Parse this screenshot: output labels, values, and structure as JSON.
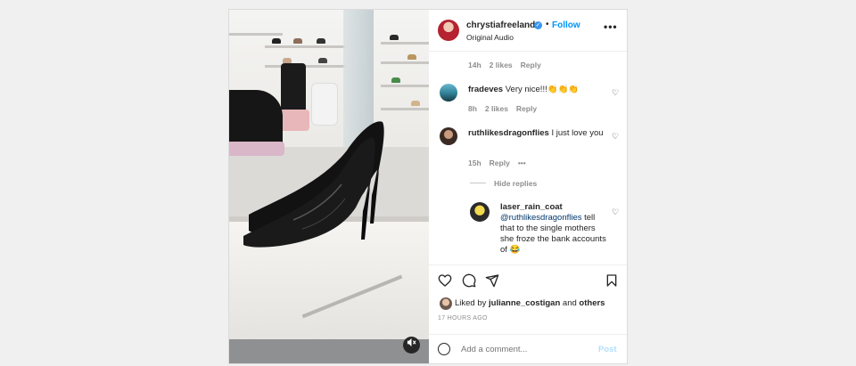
{
  "header": {
    "username": "chrystiafreeland",
    "dot": "•",
    "follow_label": "Follow",
    "audio": "Original Audio",
    "more": "•••"
  },
  "caption_meta": {
    "time": "14h",
    "likes": "2 likes",
    "reply": "Reply"
  },
  "comments": [
    {
      "user": "fradeves",
      "text": "Very nice!!!👏👏👏",
      "time": "8h",
      "likes": "2 likes",
      "reply": "Reply"
    },
    {
      "user": "ruthlikesdragonflies",
      "text": "I just love you",
      "time": "15h",
      "reply": "Reply",
      "more": "•••"
    }
  ],
  "hide_replies": "Hide replies",
  "reply_comment": {
    "user": "laser_rain_coat",
    "mention": "@ruthlikesdragonflies",
    "text": " tell that to the single mothers she froze the bank accounts of 😂"
  },
  "likes": {
    "prefix": "Liked by ",
    "user": "julianne_costigan",
    "middle": " and ",
    "others": "others"
  },
  "timestamp": "17 HOURS AGO",
  "comment_box": {
    "placeholder": "Add a comment...",
    "post_label": "Post"
  },
  "colors": {
    "link": "#0095f6",
    "verified": "#3897f0",
    "post_disabled": "#b2dffc"
  },
  "icons": [
    "heart-icon",
    "comment-icon",
    "share-icon",
    "bookmark-icon",
    "emoji-icon",
    "mute-icon",
    "more-icon",
    "verified-icon"
  ]
}
